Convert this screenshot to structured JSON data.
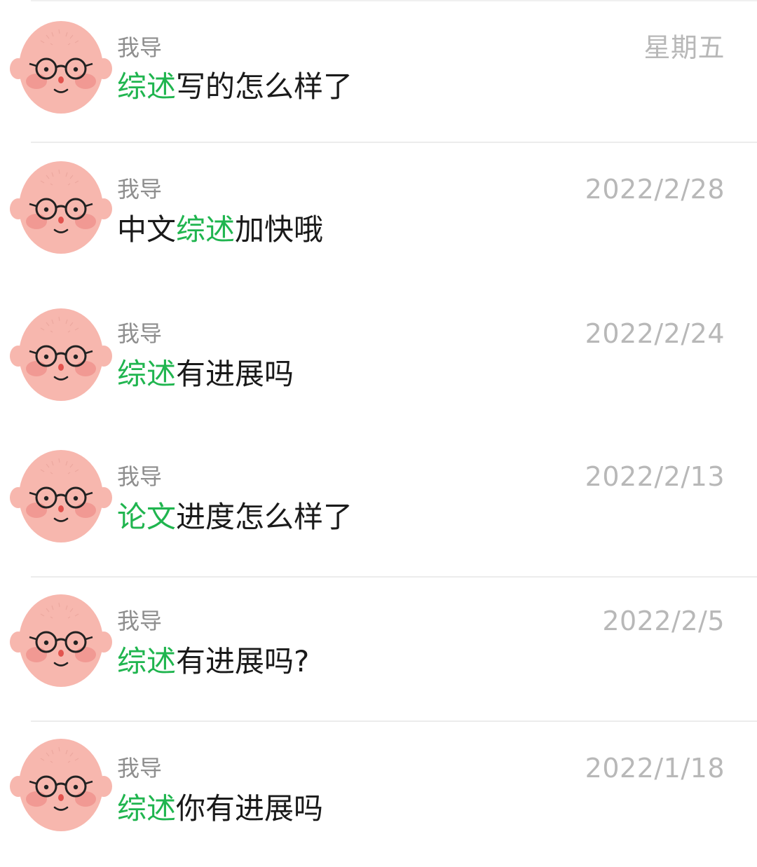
{
  "conversation_list": {
    "items": [
      {
        "sender": "我导",
        "time": "星期五",
        "message_highlight": "综述",
        "message_rest": "写的怎么样了",
        "message_prefix": ""
      },
      {
        "sender": "我导",
        "time": "2022/2/28",
        "message_prefix": "中文",
        "message_highlight": "综述",
        "message_rest": "加快哦"
      },
      {
        "sender": "我导",
        "time": "2022/2/24",
        "message_prefix": "",
        "message_highlight": "综述",
        "message_rest": "有进展吗"
      },
      {
        "sender": "我导",
        "time": "2022/2/13",
        "message_prefix": "",
        "message_highlight": "论文",
        "message_rest": "进度怎么样了"
      },
      {
        "sender": "我导",
        "time": "2022/2/5",
        "message_prefix": "",
        "message_highlight": "综述",
        "message_rest": "有进展吗?"
      },
      {
        "sender": "我导",
        "time": "2022/1/18",
        "message_prefix": "",
        "message_highlight": "综述",
        "message_rest": "你有进展吗"
      }
    ]
  },
  "colors": {
    "highlight": "#20b54f",
    "message_text": "#1a1a1a",
    "sender_text": "#8e8e8e",
    "time_text": "#b8b8b8",
    "avatar_face": "#f7b7ae"
  },
  "icons": {
    "avatar": "bald-face-with-glasses-avatar-icon"
  }
}
